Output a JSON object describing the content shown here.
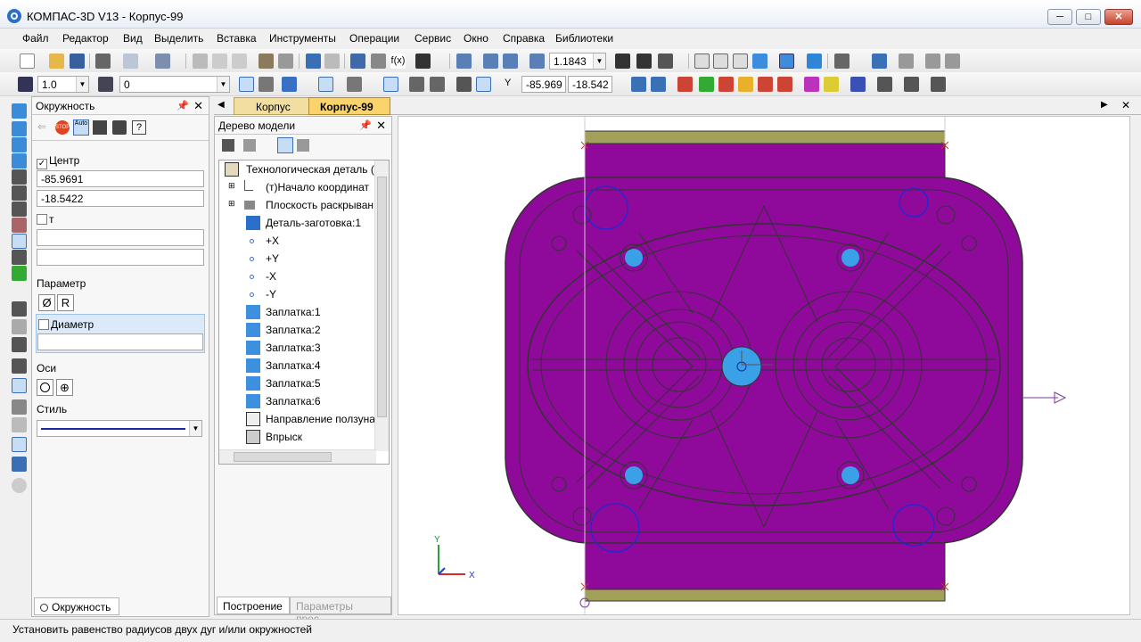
{
  "window": {
    "title": "КОМПАС-3D V13 - Корпус-99",
    "min": "─",
    "max": "□",
    "close": "✕"
  },
  "menu": [
    "Файл",
    "Редактор",
    "Вид",
    "Выделить",
    "Вставка",
    "Инструменты",
    "Операции",
    "Сервис",
    "Окно",
    "Справка",
    "Библиотеки"
  ],
  "toolbar": {
    "zoom_value": "1.1843",
    "line_scale": "1.0",
    "layer": "0",
    "coord_x": "-85.969",
    "coord_y": "-18.542",
    "label_Y_cursor": "Y"
  },
  "props_panel": {
    "title": "Окружность",
    "center_label": "Центр",
    "center_checked": "✓",
    "center_x": "-85.9691",
    "center_y": "-18.5422",
    "t_label": "т",
    "t_value": "",
    "t_value2": "",
    "param_label": "Параметр",
    "param_btn1": "Ø",
    "param_btn2": "R",
    "diameter_label": "Диаметр",
    "diameter_value": "",
    "axes_label": "Оси",
    "style_label": "Стиль",
    "bottom_tab": "Окружность"
  },
  "model_tree": {
    "title": "Дерево модели",
    "root": "Технологическая деталь (",
    "items": [
      "(т)Начало координат",
      "Плоскость раскрыван",
      "Деталь-заготовка:1",
      "+X",
      "+Y",
      "-X",
      "-Y",
      "Заплатка:1",
      "Заплатка:2",
      "Заплатка:3",
      "Заплатка:4",
      "Заплатка:5",
      "Заплатка:6",
      "Направление ползуна",
      "Впрыск"
    ],
    "tab_build": "Построение",
    "tab_params": "Параметры прес..."
  },
  "doc_tabs": [
    "Корпус",
    "Корпус-99"
  ],
  "viewport": {
    "axis_x": "X",
    "axis_y": "Y",
    "part_color": "#8f0a9a",
    "accent_blue": "#3aa0e8"
  },
  "status": "Установить равенство радиусов двух дуг и/или окружностей"
}
